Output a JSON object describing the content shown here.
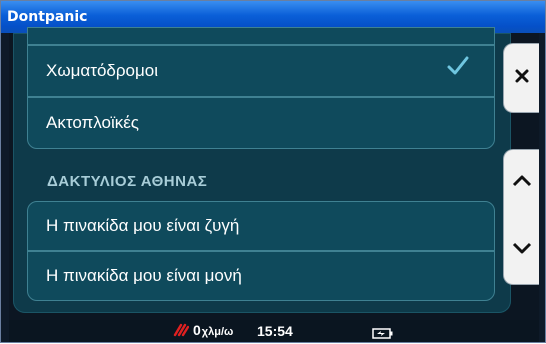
{
  "window": {
    "title": "Dontpanic"
  },
  "menu": {
    "items_top": [
      {
        "label": "Χωματόδρομοι",
        "checked": true
      },
      {
        "label": "Ακτοπλοϊκές",
        "checked": false
      }
    ],
    "section": {
      "title": "ΔΑΚΤΥΛΙΟΣ ΑΘΗΝΑΣ",
      "items": [
        {
          "label": "Η πινακίδα μου είναι ζυγή"
        },
        {
          "label": "Η πινακίδα μου είναι μονή"
        }
      ]
    }
  },
  "side_buttons": [
    {
      "icon": "close-icon"
    },
    {
      "icon": "chevron-up-icon"
    },
    {
      "icon": "chevron-down-icon"
    }
  ],
  "status": {
    "speed_value": "0",
    "speed_unit": "χλμ/ω",
    "time": "15:54",
    "battery_icon": "battery-charging-icon"
  },
  "colors": {
    "titlebar": "#0550c8",
    "panel": "#0e3a4a",
    "item": "#0f4a5c",
    "check": "#6fc6e0",
    "speed_icon": "#e02020"
  }
}
